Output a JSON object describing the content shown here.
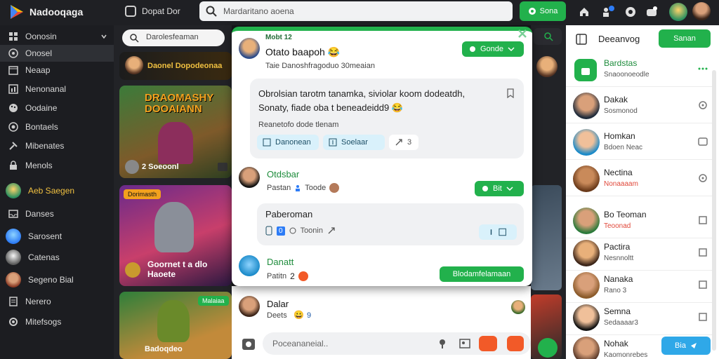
{
  "topbar": {
    "brand": "Nadooqaga",
    "nav_label": "Dopat Dor",
    "search_placeholder": "Mardaritano aoena",
    "cta_label": "Sona",
    "icons": [
      "home-icon",
      "people-icon",
      "globe-icon",
      "gamepad-icon",
      "profile-avatar",
      "user-avatar"
    ]
  },
  "sidebar": {
    "items": [
      {
        "label": "Oonosin",
        "icon": "grid-icon"
      },
      {
        "label": "Onosel",
        "icon": "compass-icon"
      },
      {
        "label": "Neaap",
        "icon": "calendar-icon"
      },
      {
        "label": "Nenonanal",
        "icon": "chart-icon"
      },
      {
        "label": "Oodaine",
        "icon": "palette-icon"
      },
      {
        "label": "Bontaels",
        "icon": "tag-icon"
      },
      {
        "label": "Mibenates",
        "icon": "tools-icon"
      },
      {
        "label": "Menols",
        "icon": "lock-icon"
      },
      {
        "label": "Aeb Saegen",
        "icon": "avatar"
      },
      {
        "label": "Danses",
        "icon": "inbox-icon"
      },
      {
        "label": "Sarosent",
        "icon": "avatar"
      },
      {
        "label": "Catenas",
        "icon": "avatar"
      },
      {
        "label": "Segeno Bial",
        "icon": "avatar"
      },
      {
        "label": "Nerero",
        "icon": "doc-icon"
      },
      {
        "label": "Mitefsogs",
        "icon": "settings-icon"
      }
    ]
  },
  "feed": {
    "search_placeholder": "Darolesfeaman",
    "cards": [
      {
        "label": "Daonel Dopodeonaa"
      },
      {
        "title": "DRAOMASHY DOOAIANN",
        "label": "2 Soeoonl"
      },
      {
        "title": "Dorimasth",
        "label": "Goornet t a dlo Haoete"
      },
      {
        "title": "Malaiaa",
        "label": "Badoqdeo"
      }
    ]
  },
  "popup": {
    "header": "Mobt 12",
    "user_name": "Otato baapoh 😂",
    "user_sub": "Taie Danoshfragoduo 30meaian",
    "follow_label": "Gonde",
    "message": "Obrolsian tarotm tanamka, siviolar koom dodeatdh, Sonaty, fiade oba t beneadeidd9 😂",
    "message_sub": "Reanetofo dode tlenam",
    "tags": [
      "Danonean",
      "Soelaar",
      "3"
    ],
    "comments": [
      {
        "name": "Otdsbar",
        "sub": "Pastan",
        "sub2": "Toode",
        "btn": "Bit",
        "reply": "Paberoman",
        "reply_tags": [
          "0",
          "Toonin"
        ]
      },
      {
        "name": "Danatt",
        "sub": "Patitn",
        "count": "2",
        "btn": "Blodamfelamaan"
      }
    ]
  },
  "below": {
    "name": "Dalar",
    "sub": "Deets",
    "count": "9",
    "composer_placeholder": "Poceananeial.."
  },
  "rpanel": {
    "title": "Deeanvog",
    "button": "Sanan",
    "group_name": "Bardstas",
    "group_sub": "Snaoonoeodle",
    "users": [
      {
        "name": "Dakak",
        "status": "Sosmonod"
      },
      {
        "name": "Homkan",
        "status": "Bdoen Neac"
      },
      {
        "name": "Nectina",
        "status": "Nonaaaam"
      },
      {
        "name": "Bo Teoman",
        "status": "Teoonad"
      },
      {
        "name": "Pactira",
        "status": "Nesnnoltt"
      },
      {
        "name": "Nanaka",
        "status": "Rano 3"
      },
      {
        "name": "Semna",
        "status": "Sedaaaar3"
      },
      {
        "name": "Nohak",
        "status": "Kaomonrebes"
      }
    ],
    "chat_btn": "Bia"
  },
  "colors": {
    "accent": "#22b14c",
    "sidebar_bg": "#1c1d21",
    "topbar_bg": "#1f2024",
    "tag_bg": "#d9f1fb",
    "alert": "#f25a28"
  }
}
